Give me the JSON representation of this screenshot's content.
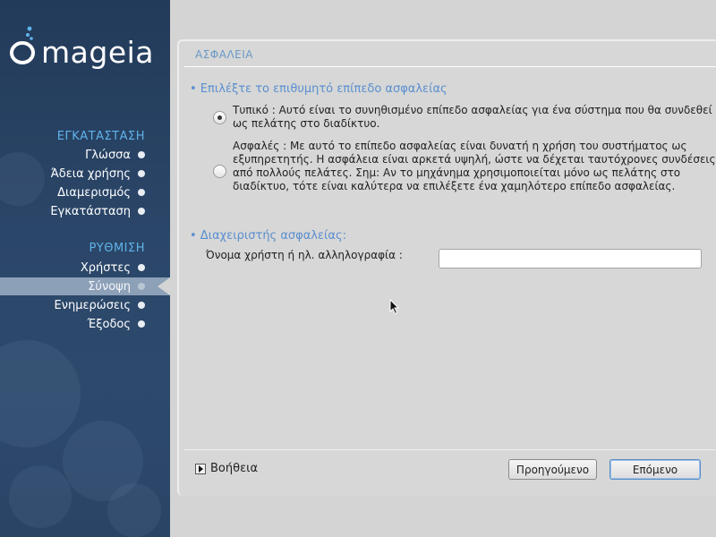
{
  "app": {
    "logo_text": "mageia"
  },
  "sidebar": {
    "sections": [
      {
        "title": "ΕΓΚΑΤΑΣΤΑΣΗ",
        "items": [
          "Γλώσσα",
          "Άδεια χρήσης",
          "Διαμερισμός",
          "Εγκατάσταση"
        ]
      },
      {
        "title": "ΡΥΘΜΙΣΗ",
        "items": [
          "Χρήστες",
          "Σύνοψη",
          "Ενημερώσεις",
          "Έξοδος"
        ]
      }
    ],
    "active_item": "Σύνοψη",
    "colors": {
      "background": "#2a4567",
      "section_title": "#5fb3ea",
      "active_item": "#8ca0b8"
    }
  },
  "panel": {
    "title": "ΑΣΦΑΛΕΙΑ",
    "security_level": {
      "heading": "• Επιλέξτε το επιθυμητό επίπεδο ασφαλείας",
      "options": [
        {
          "text": "Τυπικό : Αυτό είναι το συνηθισμένο επίπεδο ασφαλείας για ένα σύστημα που θα συνδεθεί ως πελάτης στο διαδίκτυο.",
          "selected": true
        },
        {
          "text": "Ασφαλές : Με αυτό το επίπεδο ασφαλείας είναι δυνατή η χρήση του συστήματος ως εξυπηρετητής. Η ασφάλεια είναι αρκετά υψηλή, ώστε να δέχεται ταυτόχρονες συνδέσεις από πολλούς πελάτες. Σημ: Αν το μηχάνημα χρησιμοποιείται μόνο ως πελάτης στο διαδίκτυο, τότε είναι καλύτερα να επιλέξετε ένα χαμηλότερο επίπεδο ασφαλείας.",
          "selected": false
        }
      ]
    },
    "admin": {
      "heading": "• Διαχειριστής ασφαλείας:",
      "field_label": "Όνομα χρήστη ή ηλ. αλληλογραφία :",
      "field_value": ""
    },
    "help_label": "Βοήθεια",
    "prev_label": "Προηγούμενο",
    "next_label": "Επόμενο"
  }
}
